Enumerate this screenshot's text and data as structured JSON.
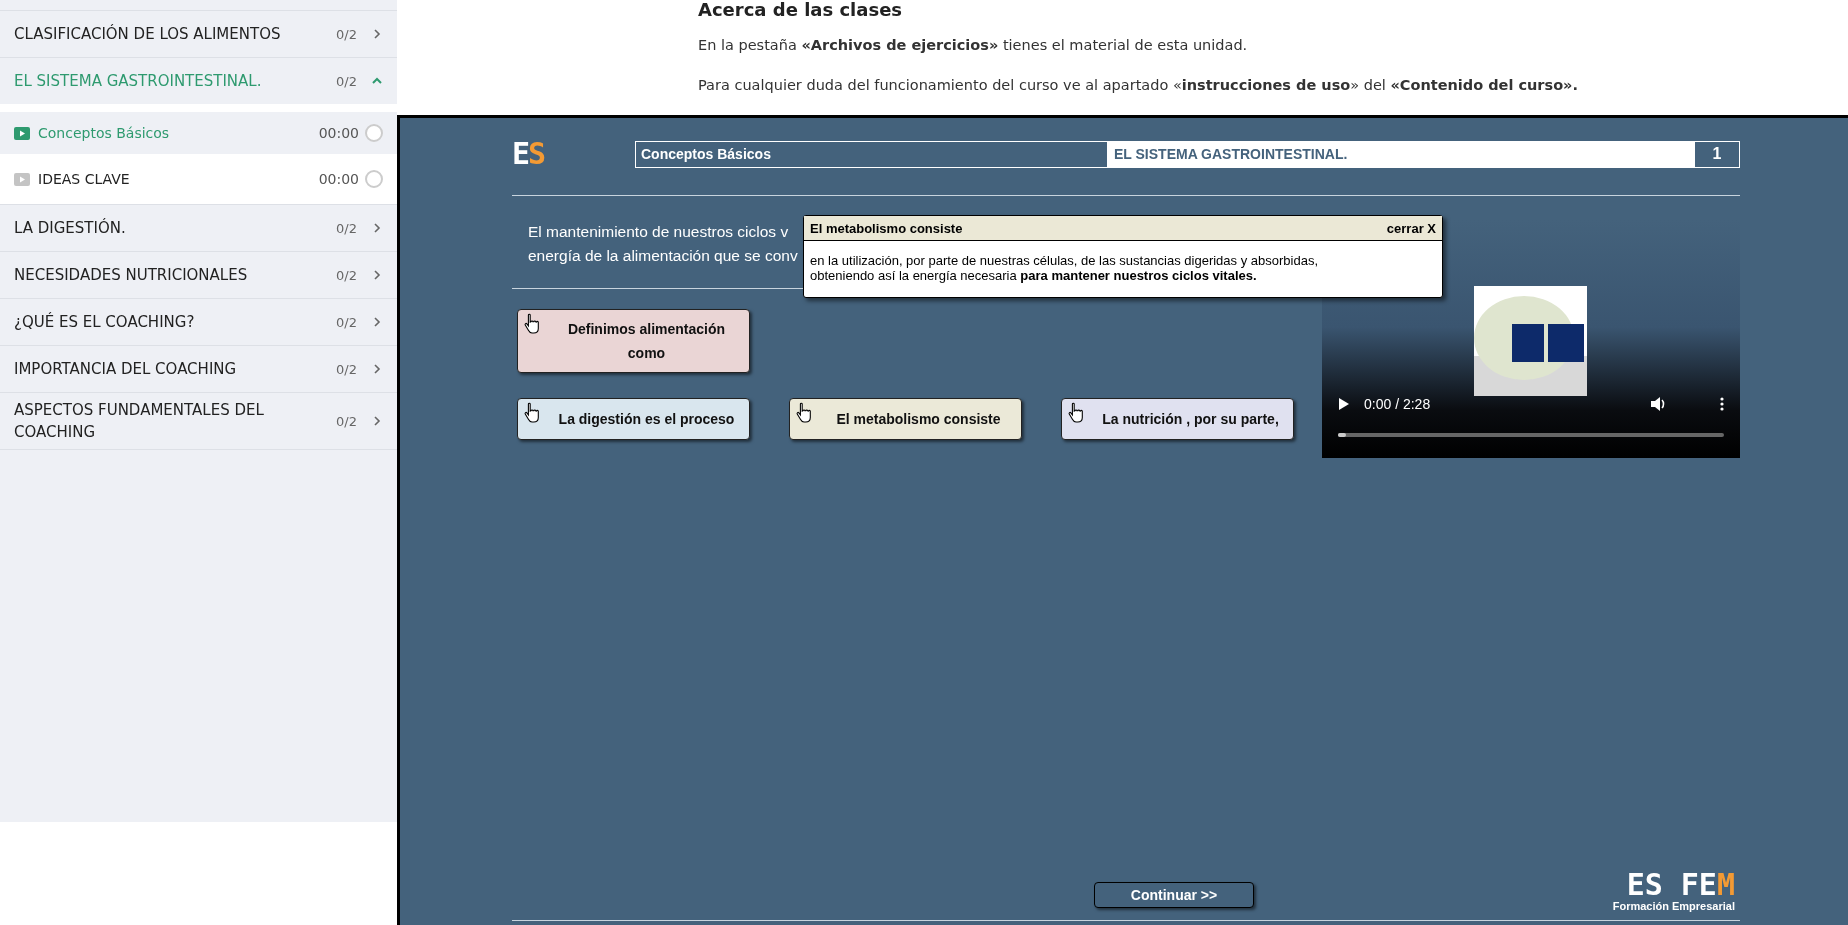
{
  "sidebar": {
    "sections": [
      {
        "title": "CLASIFICACIÓN DE LOS ALIMENTOS",
        "count": "0/2",
        "expanded": false
      },
      {
        "title": "EL SISTEMA GASTROINTESTINAL.",
        "count": "0/2",
        "expanded": true,
        "lessons": [
          {
            "title": "Conceptos Básicos",
            "time": "00:00",
            "selected": true,
            "completed": false
          },
          {
            "title": "IDEAS CLAVE",
            "time": "00:00",
            "selected": false,
            "completed": false
          }
        ]
      },
      {
        "title": "LA DIGESTIÓN.",
        "count": "0/2",
        "expanded": false
      },
      {
        "title": "NECESIDADES NUTRICIONALES",
        "count": "0/2",
        "expanded": false
      },
      {
        "title": "¿QUÉ ES EL COACHING?",
        "count": "0/2",
        "expanded": false
      },
      {
        "title": "IMPORTANCIA DEL COACHING",
        "count": "0/2",
        "expanded": false
      },
      {
        "title": "ASPECTOS FUNDAMENTALES DEL COACHING",
        "count": "0/2",
        "expanded": false
      }
    ]
  },
  "about": {
    "title": "Acerca de las clases",
    "paragraphs": [
      "En la pestaña **«Archivos de ejercicios»** tienes el material de esta unidad.",
      "Para cualquier duda del funcionamiento del curso ve al apartado «**instrucciones de uso**» del **«Contenido del curso».**"
    ]
  },
  "slide": {
    "logo": [
      "E",
      "S"
    ],
    "header": {
      "lesson": "Conceptos Básicos",
      "unit": "EL SISTEMA GASTROINTESTINAL.",
      "page": "1"
    },
    "intro_lines": [
      "El mantenimiento de nuestros ciclos v",
      "energía de la alimentación que se conv"
    ],
    "popup": {
      "title": "El metabolismo consiste",
      "close": "cerrar X",
      "body": "en la utilización, por parte de nuestras células, de las sustancias digeridas y absorbidas, obteniendo así la energía necesaria **para mantener nuestros ciclos vitales.**"
    },
    "cards": [
      {
        "label": "Definimos alimentación como",
        "color": "#ead5d5"
      },
      {
        "label": "La digestión es el proceso",
        "color": "#d9e6ee"
      },
      {
        "label": "El metabolismo consiste",
        "color": "#ebe9d8"
      },
      {
        "label": "La nutrición , por su parte,",
        "color": "#e0e1f0"
      }
    ],
    "video": {
      "time": "0:00 / 2:28",
      "level": 0.02
    },
    "continue": "Continuar >>",
    "brand": {
      "name": [
        "ES FE",
        "M"
      ],
      "tagline": "Formación Empresarial"
    }
  }
}
